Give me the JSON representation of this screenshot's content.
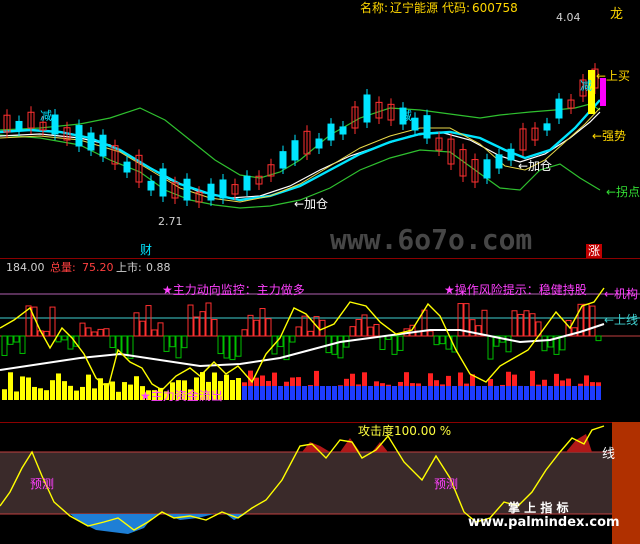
{
  "header": {
    "name_label": "名称:",
    "name_value": "辽宁能源",
    "code_label": "代码:",
    "code_value": "600758"
  },
  "price_panel": {
    "high_price": "4.04",
    "low_price": "2.71",
    "labels": {
      "dragon": "龙",
      "buy": "←上买",
      "strong": "←强势",
      "turning": "←拐点",
      "add_pos_1": "←加仓",
      "add_pos_2": "←加仓",
      "reduce_1": "减",
      "reduce_2": "减",
      "reduce_3": "减",
      "cai": "财",
      "zhang": "涨"
    }
  },
  "indicator_panel": {
    "stats": {
      "value_1": "184.00",
      "total_label": "总量:",
      "total_value": "75.20",
      "up_label": "上市:",
      "up_value": "0.88"
    },
    "monitor_title": "★主力动向监控：主力做多",
    "risk_title": "★操作风险提示：稳健持股",
    "side_label_1": "←机构",
    "side_label_2": "←上线",
    "bottom_label": "★主力资金流出"
  },
  "attack_panel": {
    "title": "攻击度100.00 %",
    "left_label": "预测",
    "mid_label": "预测",
    "right_label": "线"
  },
  "watermarks": {
    "site": "www.6o7o.com",
    "brand_cn": "掌 上 指 标",
    "brand_url": "www.palmindex.com"
  },
  "colors": {
    "up": "#ff3030",
    "down": "#00ffff",
    "yellow": "#ffff00",
    "magenta": "#ff00ff",
    "white": "#ffffff",
    "green": "#00c000",
    "blue": "#1e3cff"
  }
}
